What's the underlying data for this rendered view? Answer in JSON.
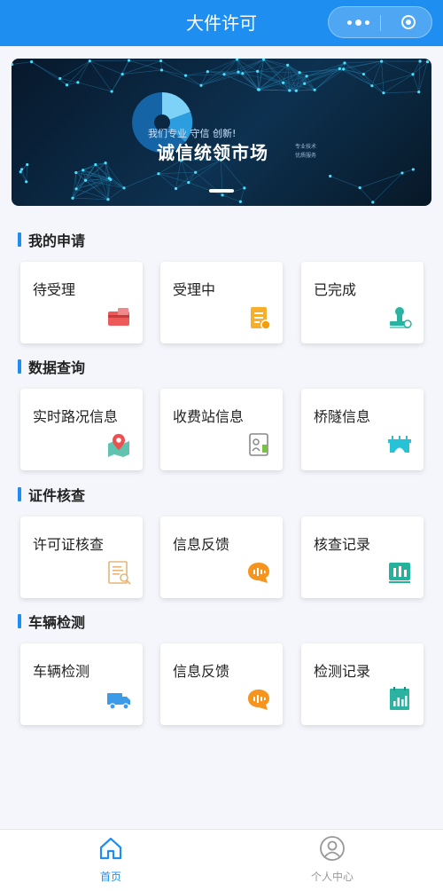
{
  "nav": {
    "title": "大件许可"
  },
  "banner": {
    "slogan": "我们专业 守信 创新!",
    "headline": "诚信统领市场",
    "side_line1": "专业技术",
    "side_line2": "优质服务"
  },
  "sections": [
    {
      "title": "我的申请",
      "items": [
        {
          "label": "待受理",
          "icon": "payment-card-icon"
        },
        {
          "label": "受理中",
          "icon": "document-list-icon"
        },
        {
          "label": "已完成",
          "icon": "stamp-icon"
        }
      ]
    },
    {
      "title": "数据查询",
      "items": [
        {
          "label": "实时路况信息",
          "icon": "map-pin-icon"
        },
        {
          "label": "收费站信息",
          "icon": "toll-station-icon"
        },
        {
          "label": "桥隧信息",
          "icon": "bridge-icon"
        }
      ]
    },
    {
      "title": "证件核查",
      "items": [
        {
          "label": "许可证核查",
          "icon": "certificate-search-icon"
        },
        {
          "label": "信息反馈",
          "icon": "chat-bubble-icon"
        },
        {
          "label": "核查记录",
          "icon": "bar-chart-icon"
        }
      ]
    },
    {
      "title": "车辆检测",
      "items": [
        {
          "label": "车辆检测",
          "icon": "truck-icon"
        },
        {
          "label": "信息反馈",
          "icon": "chat-bubble-icon"
        },
        {
          "label": "检测记录",
          "icon": "stats-calendar-icon"
        }
      ]
    }
  ],
  "tabbar": [
    {
      "label": "首页",
      "icon": "home-icon",
      "active": true
    },
    {
      "label": "个人中心",
      "icon": "user-icon",
      "active": false
    }
  ],
  "colors": {
    "primary": "#1e8ff0",
    "background": "#f4f6fb",
    "inactive": "#999999"
  }
}
